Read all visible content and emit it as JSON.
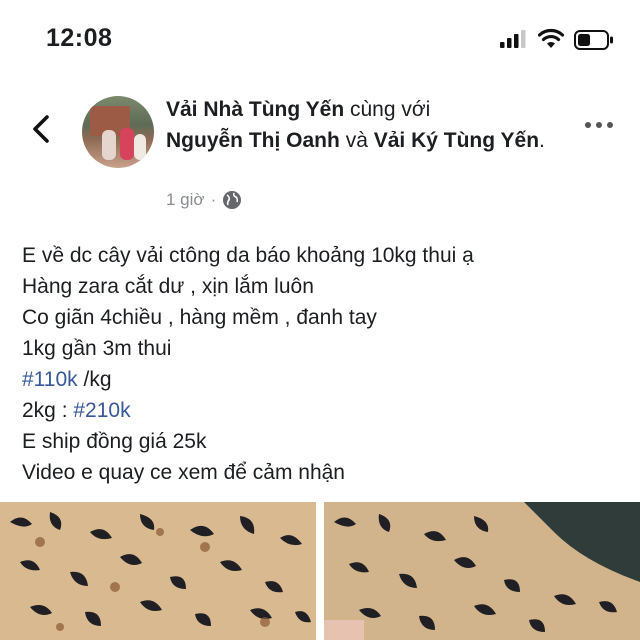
{
  "status_bar": {
    "time": "12:08"
  },
  "post": {
    "author": "Vải Nhà Tùng Yến",
    "with_text": "cùng với",
    "tagged_1": "Nguyễn Thị Oanh",
    "and_text": "và",
    "tagged_2": "Vải Ký Tùng Yến",
    "period": ".",
    "time": "1 giờ",
    "dot": "·",
    "lines": [
      "E về dc cây vải ctông da báo khoảng 10kg thui ạ",
      "Hàng zara cắt dư , xịn lắm luôn",
      "Co giãn 4chiều , hàng mềm , đanh tay",
      "1kg gần 3m thui"
    ],
    "price_tag": "#110k",
    "price_unit": " /kg",
    "bulk_prefix": "2kg : ",
    "bulk_tag": "#210k",
    "shipping": "E ship đồng giá 25k",
    "video": "Video e quay ce xem để cảm nhận"
  },
  "icons": [
    "back-arrow-icon",
    "more-options-icon",
    "globe-icon",
    "signal-icon",
    "wifi-icon",
    "battery-icon"
  ],
  "colors": {
    "link": "#385898",
    "meta": "#8a8d91",
    "text": "#1c1e21"
  }
}
